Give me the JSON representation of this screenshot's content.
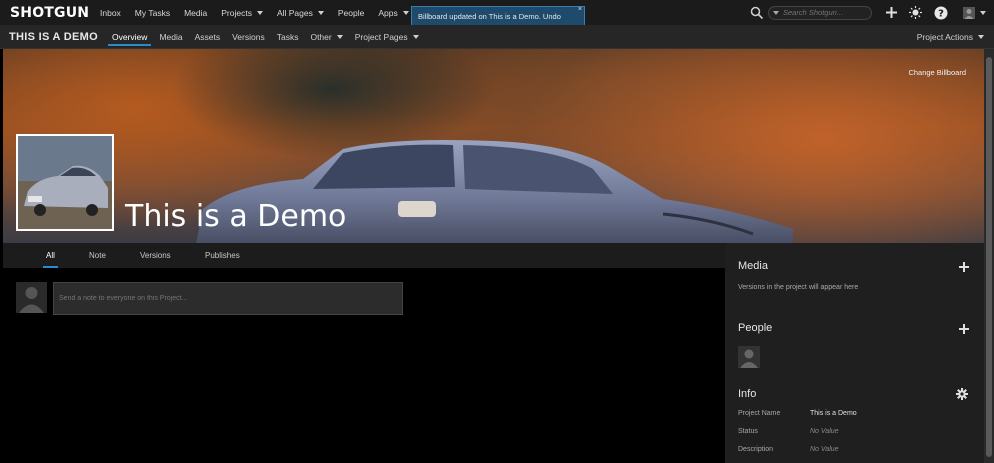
{
  "app": {
    "logo": "SHOTGUN"
  },
  "topnav": {
    "items": [
      {
        "label": "Inbox",
        "dropdown": false
      },
      {
        "label": "My Tasks",
        "dropdown": false
      },
      {
        "label": "Media",
        "dropdown": false
      },
      {
        "label": "Projects",
        "dropdown": true
      },
      {
        "label": "All Pages",
        "dropdown": true
      },
      {
        "label": "People",
        "dropdown": false
      },
      {
        "label": "Apps",
        "dropdown": true
      }
    ],
    "search_placeholder": "Search Shotgun..."
  },
  "toast": {
    "message": "Billboard updated on This is a Demo. Undo",
    "close": "×"
  },
  "project": {
    "name": "THIS IS A DEMO",
    "title": "This is a Demo",
    "tabs": [
      {
        "label": "Overview",
        "active": true,
        "dropdown": false
      },
      {
        "label": "Media",
        "active": false,
        "dropdown": false
      },
      {
        "label": "Assets",
        "active": false,
        "dropdown": false
      },
      {
        "label": "Versions",
        "active": false,
        "dropdown": false
      },
      {
        "label": "Tasks",
        "active": false,
        "dropdown": false
      },
      {
        "label": "Other",
        "active": false,
        "dropdown": true
      },
      {
        "label": "Project Pages",
        "active": false,
        "dropdown": true
      }
    ],
    "actions_label": "Project Actions",
    "change_billboard": "Change Billboard"
  },
  "feed": {
    "tabs": [
      {
        "label": "All",
        "active": true
      },
      {
        "label": "Note",
        "active": false
      },
      {
        "label": "Versions",
        "active": false
      },
      {
        "label": "Publishes",
        "active": false
      }
    ],
    "note_placeholder": "Send a note to everyone on this Project..."
  },
  "sidebar": {
    "media": {
      "title": "Media",
      "empty_text": "Versions in the project will appear here"
    },
    "people": {
      "title": "People"
    },
    "info": {
      "title": "Info",
      "rows": [
        {
          "label": "Project Name",
          "value": "This is a Demo",
          "empty": false
        },
        {
          "label": "Status",
          "value": "No Value",
          "empty": true
        },
        {
          "label": "Description",
          "value": "No Value",
          "empty": true
        }
      ]
    }
  },
  "colors": {
    "accent": "#2b8acb",
    "toast_bg": "#1e4a6b",
    "background": "#000000",
    "panel": "#1f1f1f"
  },
  "icons": [
    "search-icon",
    "plus-icon",
    "brightness-icon",
    "help-icon",
    "user-icon",
    "gear-icon",
    "avatar-icon"
  ]
}
